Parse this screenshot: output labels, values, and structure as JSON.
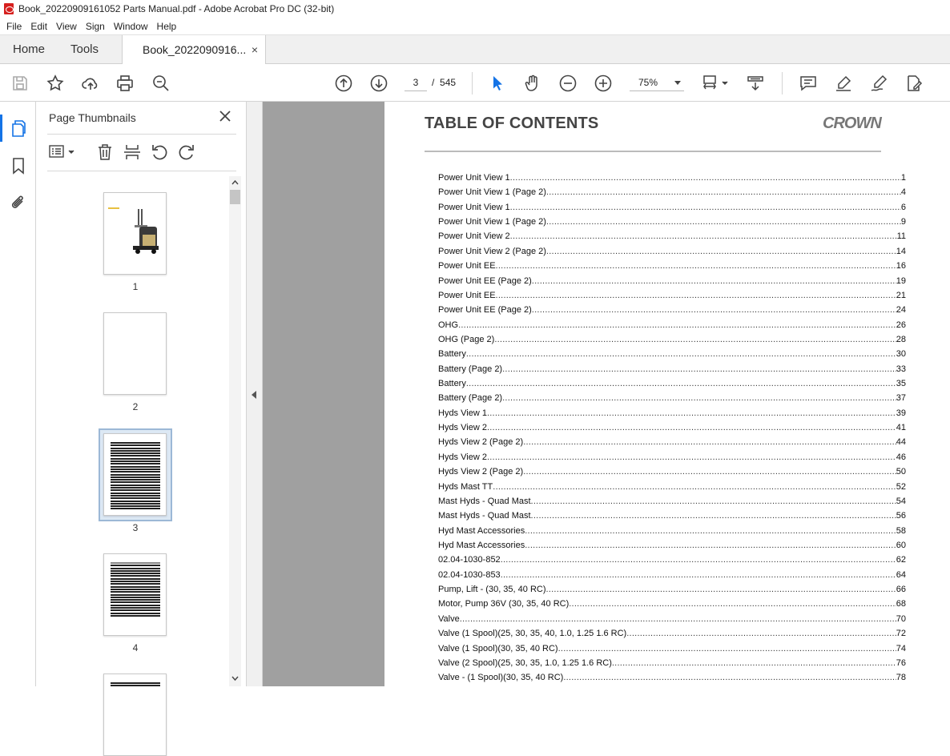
{
  "window": {
    "title": "Book_20220909161052 Parts Manual.pdf - Adobe Acrobat Pro DC (32-bit)"
  },
  "menu": [
    "File",
    "Edit",
    "View",
    "Sign",
    "Window",
    "Help"
  ],
  "tabs": {
    "home": "Home",
    "tools": "Tools",
    "document": "Book_2022090916...",
    "close": "×"
  },
  "toolbar": {
    "current_page": "3",
    "page_separator": "/",
    "total_pages": "545",
    "zoom": "75%"
  },
  "thumbnails_panel": {
    "title": "Page Thumbnails",
    "close": "✕",
    "pages": [
      "1",
      "2",
      "3",
      "4"
    ],
    "selected_page": "3"
  },
  "document": {
    "title": "TABLE OF CONTENTS",
    "logo_text": "CROWN",
    "toc": [
      {
        "label": "Power Unit View 1",
        "page": "1"
      },
      {
        "label": "Power Unit View 1 (Page 2)",
        "page": "4"
      },
      {
        "label": "Power Unit View 1",
        "page": "6"
      },
      {
        "label": "Power Unit View 1 (Page 2)",
        "page": "9"
      },
      {
        "label": "Power Unit View 2",
        "page": "11"
      },
      {
        "label": "Power Unit View 2 (Page 2)",
        "page": "14"
      },
      {
        "label": "Power Unit EE",
        "page": "16"
      },
      {
        "label": "Power Unit EE (Page 2)",
        "page": "19"
      },
      {
        "label": "Power Unit EE",
        "page": "21"
      },
      {
        "label": "Power Unit EE (Page 2)",
        "page": "24"
      },
      {
        "label": "OHG",
        "page": "26"
      },
      {
        "label": "OHG (Page 2)",
        "page": "28"
      },
      {
        "label": "Battery",
        "page": "30"
      },
      {
        "label": "Battery (Page 2)",
        "page": "33"
      },
      {
        "label": "Battery",
        "page": "35"
      },
      {
        "label": "Battery (Page 2)",
        "page": "37"
      },
      {
        "label": "Hyds View 1",
        "page": "39"
      },
      {
        "label": "Hyds View 2",
        "page": "41"
      },
      {
        "label": "Hyds View 2 (Page 2)",
        "page": "44"
      },
      {
        "label": "Hyds View 2",
        "page": "46"
      },
      {
        "label": "Hyds View 2 (Page 2)",
        "page": "50"
      },
      {
        "label": "Hyds Mast TT",
        "page": "52"
      },
      {
        "label": "Mast Hyds - Quad Mast",
        "page": "54"
      },
      {
        "label": "Mast Hyds - Quad Mast",
        "page": "56"
      },
      {
        "label": "Hyd Mast Accessories",
        "page": "58"
      },
      {
        "label": "Hyd Mast Accessories",
        "page": "60"
      },
      {
        "label": "02.04-1030-852",
        "page": "62"
      },
      {
        "label": "02.04-1030-853",
        "page": "64"
      },
      {
        "label": "Pump, Lift -  (30, 35, 40 RC)",
        "page": "66"
      },
      {
        "label": "Motor, Pump 36V (30, 35, 40 RC)",
        "page": "68"
      },
      {
        "label": "Valve",
        "page": "70"
      },
      {
        "label": "Valve (1 Spool)(25, 30, 35, 40, 1.0, 1.25 1.6 RC)",
        "page": "72"
      },
      {
        "label": "Valve (1 Spool)(30, 35, 40 RC)",
        "page": "74"
      },
      {
        "label": "Valve (2 Spool)(25, 30, 35, 1.0, 1.25 1.6 RC)",
        "page": "76"
      },
      {
        "label": "Valve - (1 Spool)(30, 35, 40 RC)",
        "page": "78"
      }
    ]
  }
}
